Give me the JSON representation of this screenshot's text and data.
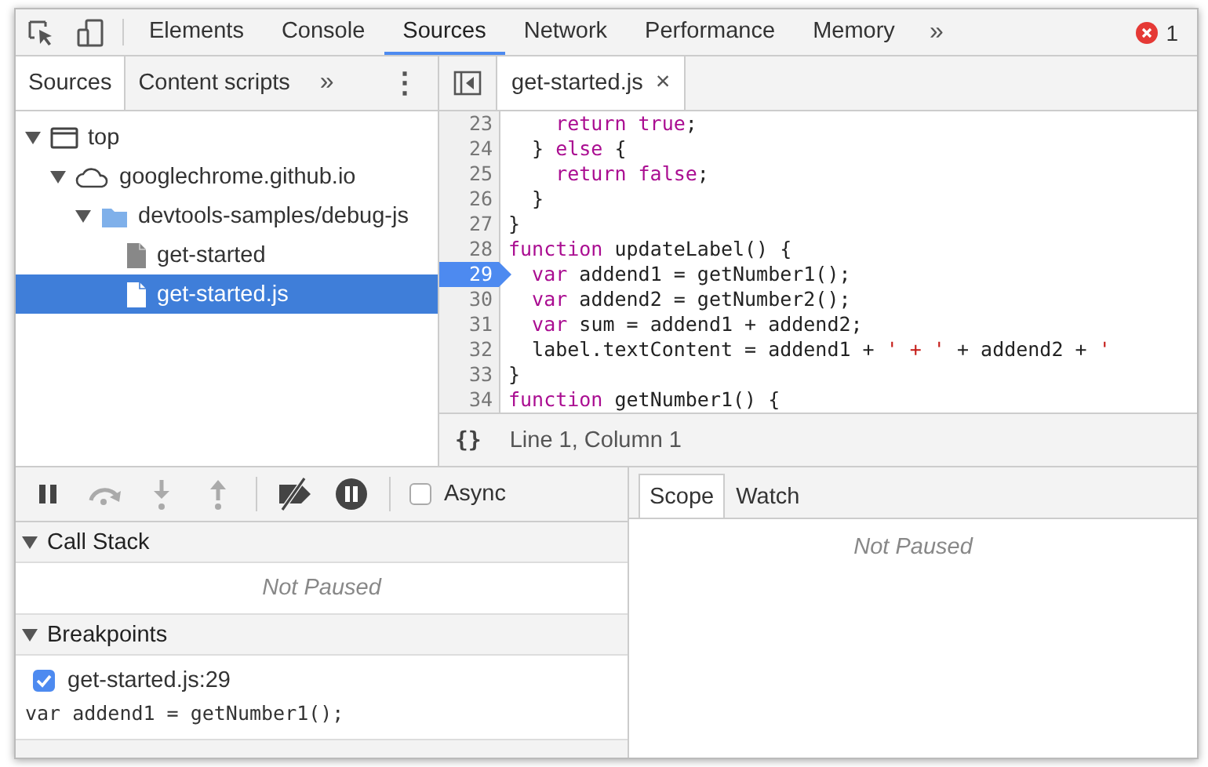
{
  "toolbar": {
    "tabs": [
      {
        "label": "Elements",
        "selected": false
      },
      {
        "label": "Console",
        "selected": false
      },
      {
        "label": "Sources",
        "selected": true
      },
      {
        "label": "Network",
        "selected": false
      },
      {
        "label": "Performance",
        "selected": false
      },
      {
        "label": "Memory",
        "selected": false
      }
    ],
    "more": "»",
    "error_count": "1"
  },
  "navigator": {
    "tabs": [
      {
        "label": "Sources",
        "selected": true
      },
      {
        "label": "Content scripts",
        "selected": false
      }
    ],
    "more": "»",
    "menu": "⋮",
    "tree": [
      {
        "label": "top",
        "kind": "frame",
        "expanded": true,
        "selected": false,
        "children": [
          {
            "label": "googlechrome.github.io",
            "kind": "domain",
            "expanded": true,
            "selected": false,
            "children": [
              {
                "label": "devtools-samples/debug-js",
                "kind": "folder",
                "expanded": true,
                "selected": false,
                "children": [
                  {
                    "label": "get-started",
                    "kind": "file",
                    "selected": false
                  },
                  {
                    "label": "get-started.js",
                    "kind": "file",
                    "selected": true
                  }
                ]
              }
            ]
          }
        ]
      }
    ]
  },
  "editor": {
    "tabs": [
      {
        "label": "get-started.js",
        "close": "×",
        "selected": true
      }
    ],
    "lines": [
      {
        "number": "23",
        "breakpoint": false,
        "tokens": [
          {
            "kind": "keyword",
            "text": "    return true"
          },
          {
            "kind": "plain",
            "text": ";"
          }
        ]
      },
      {
        "number": "24",
        "breakpoint": false,
        "tokens": [
          {
            "kind": "plain",
            "text": "  } "
          },
          {
            "kind": "keyword",
            "text": "else"
          },
          {
            "kind": "plain",
            "text": " {"
          }
        ]
      },
      {
        "number": "25",
        "breakpoint": false,
        "tokens": [
          {
            "kind": "keyword",
            "text": "    return false"
          },
          {
            "kind": "plain",
            "text": ";"
          }
        ]
      },
      {
        "number": "26",
        "breakpoint": false,
        "tokens": [
          {
            "kind": "plain",
            "text": "  }"
          }
        ]
      },
      {
        "number": "27",
        "breakpoint": false,
        "tokens": [
          {
            "kind": "plain",
            "text": "}"
          }
        ]
      },
      {
        "number": "28",
        "breakpoint": false,
        "tokens": [
          {
            "kind": "keyword",
            "text": "function"
          },
          {
            "kind": "plain",
            "text": " updateLabel() {"
          }
        ]
      },
      {
        "number": "29",
        "breakpoint": true,
        "tokens": [
          {
            "kind": "keyword",
            "text": "  var"
          },
          {
            "kind": "plain",
            "text": " addend1 = getNumber1();"
          }
        ]
      },
      {
        "number": "30",
        "breakpoint": false,
        "tokens": [
          {
            "kind": "keyword",
            "text": "  var"
          },
          {
            "kind": "plain",
            "text": " addend2 = getNumber2();"
          }
        ]
      },
      {
        "number": "31",
        "breakpoint": false,
        "tokens": [
          {
            "kind": "keyword",
            "text": "  var"
          },
          {
            "kind": "plain",
            "text": " sum = addend1 + addend2;"
          }
        ]
      },
      {
        "number": "32",
        "breakpoint": false,
        "tokens": [
          {
            "kind": "plain",
            "text": "  label.textContent = addend1 + "
          },
          {
            "kind": "string",
            "text": "' + '"
          },
          {
            "kind": "plain",
            "text": " + addend2 + "
          },
          {
            "kind": "string",
            "text": "'"
          }
        ]
      },
      {
        "number": "33",
        "breakpoint": false,
        "tokens": [
          {
            "kind": "plain",
            "text": "}"
          }
        ]
      },
      {
        "number": "34",
        "breakpoint": false,
        "tokens": [
          {
            "kind": "keyword",
            "text": "function"
          },
          {
            "kind": "plain",
            "text": " getNumber1() {"
          }
        ]
      }
    ],
    "status": {
      "format": "{}",
      "position": "Line 1, Column 1"
    }
  },
  "debugger": {
    "controls": [
      {
        "kind": "pause",
        "disabled": false
      },
      {
        "kind": "step-over",
        "disabled": true
      },
      {
        "kind": "step-into",
        "disabled": true
      },
      {
        "kind": "step-out",
        "disabled": true
      },
      {
        "kind": "deactivate",
        "disabled": false
      },
      {
        "kind": "pause-exceptions",
        "disabled": false
      }
    ],
    "async": {
      "label": "Async",
      "checked": false
    },
    "sections": [
      {
        "title": "Call Stack",
        "expanded": true,
        "message": "Not Paused"
      },
      {
        "title": "Breakpoints",
        "expanded": true,
        "breakpoints": [
          {
            "label": "get-started.js:29",
            "checked": true,
            "code": "var addend1 = getNumber1();"
          }
        ]
      }
    ]
  },
  "sidebar": {
    "tabs": [
      {
        "label": "Scope",
        "selected": true
      },
      {
        "label": "Watch",
        "selected": false
      }
    ],
    "message": "Not Paused"
  }
}
